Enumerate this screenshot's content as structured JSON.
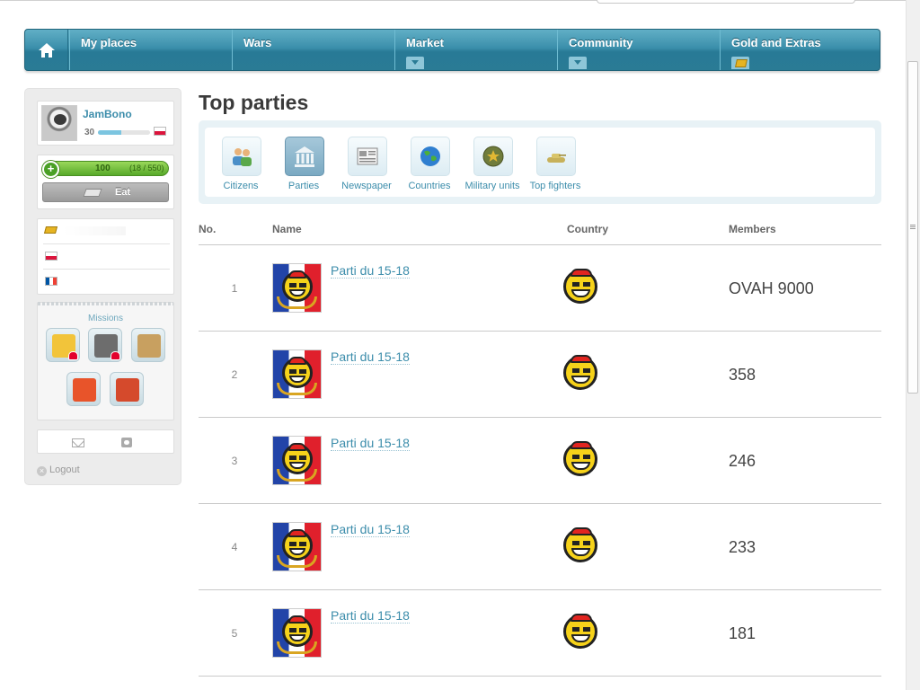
{
  "nav": {
    "home_icon": "home-icon",
    "items": [
      {
        "label": "My places",
        "has_arrow": false
      },
      {
        "label": "Wars",
        "has_arrow": false
      },
      {
        "label": "Market",
        "has_arrow": true
      },
      {
        "label": "Community",
        "has_arrow": true
      },
      {
        "label": "Gold and Extras",
        "has_arrow": false
      }
    ]
  },
  "user": {
    "name": "JamBono",
    "level": "30",
    "xp_fraction": 0.45,
    "health_value": "100",
    "health_max": "(18 / 550)",
    "eat_label": "Eat"
  },
  "missions": {
    "title": "Missions"
  },
  "sidebar": {
    "logout_label": "Logout"
  },
  "page": {
    "title": "Top parties"
  },
  "categories": [
    {
      "label": "Citizens",
      "icon": "citizens-icon"
    },
    {
      "label": "Parties",
      "icon": "parties-icon",
      "active": true
    },
    {
      "label": "Newspaper",
      "icon": "newspaper-icon"
    },
    {
      "label": "Countries",
      "icon": "globe-icon"
    },
    {
      "label": "Military units",
      "icon": "military-unit-icon"
    },
    {
      "label": "Top fighters",
      "icon": "tank-icon"
    }
  ],
  "table": {
    "headers": {
      "no": "No.",
      "name": "Name",
      "country": "Country",
      "members": "Members"
    },
    "rows": [
      {
        "rank": "1",
        "name": "Parti du 15-18",
        "members": "OVAH 9000"
      },
      {
        "rank": "2",
        "name": "Parti du 15-18",
        "members": "358"
      },
      {
        "rank": "3",
        "name": "Parti du 15-18",
        "members": "246"
      },
      {
        "rank": "4",
        "name": "Parti du 15-18",
        "members": "233"
      },
      {
        "rank": "5",
        "name": "Parti du 15-18",
        "members": "181"
      }
    ]
  },
  "colors": {
    "accent": "#3c8dab",
    "nav": "#2a7b95",
    "health": "#58a92a"
  }
}
